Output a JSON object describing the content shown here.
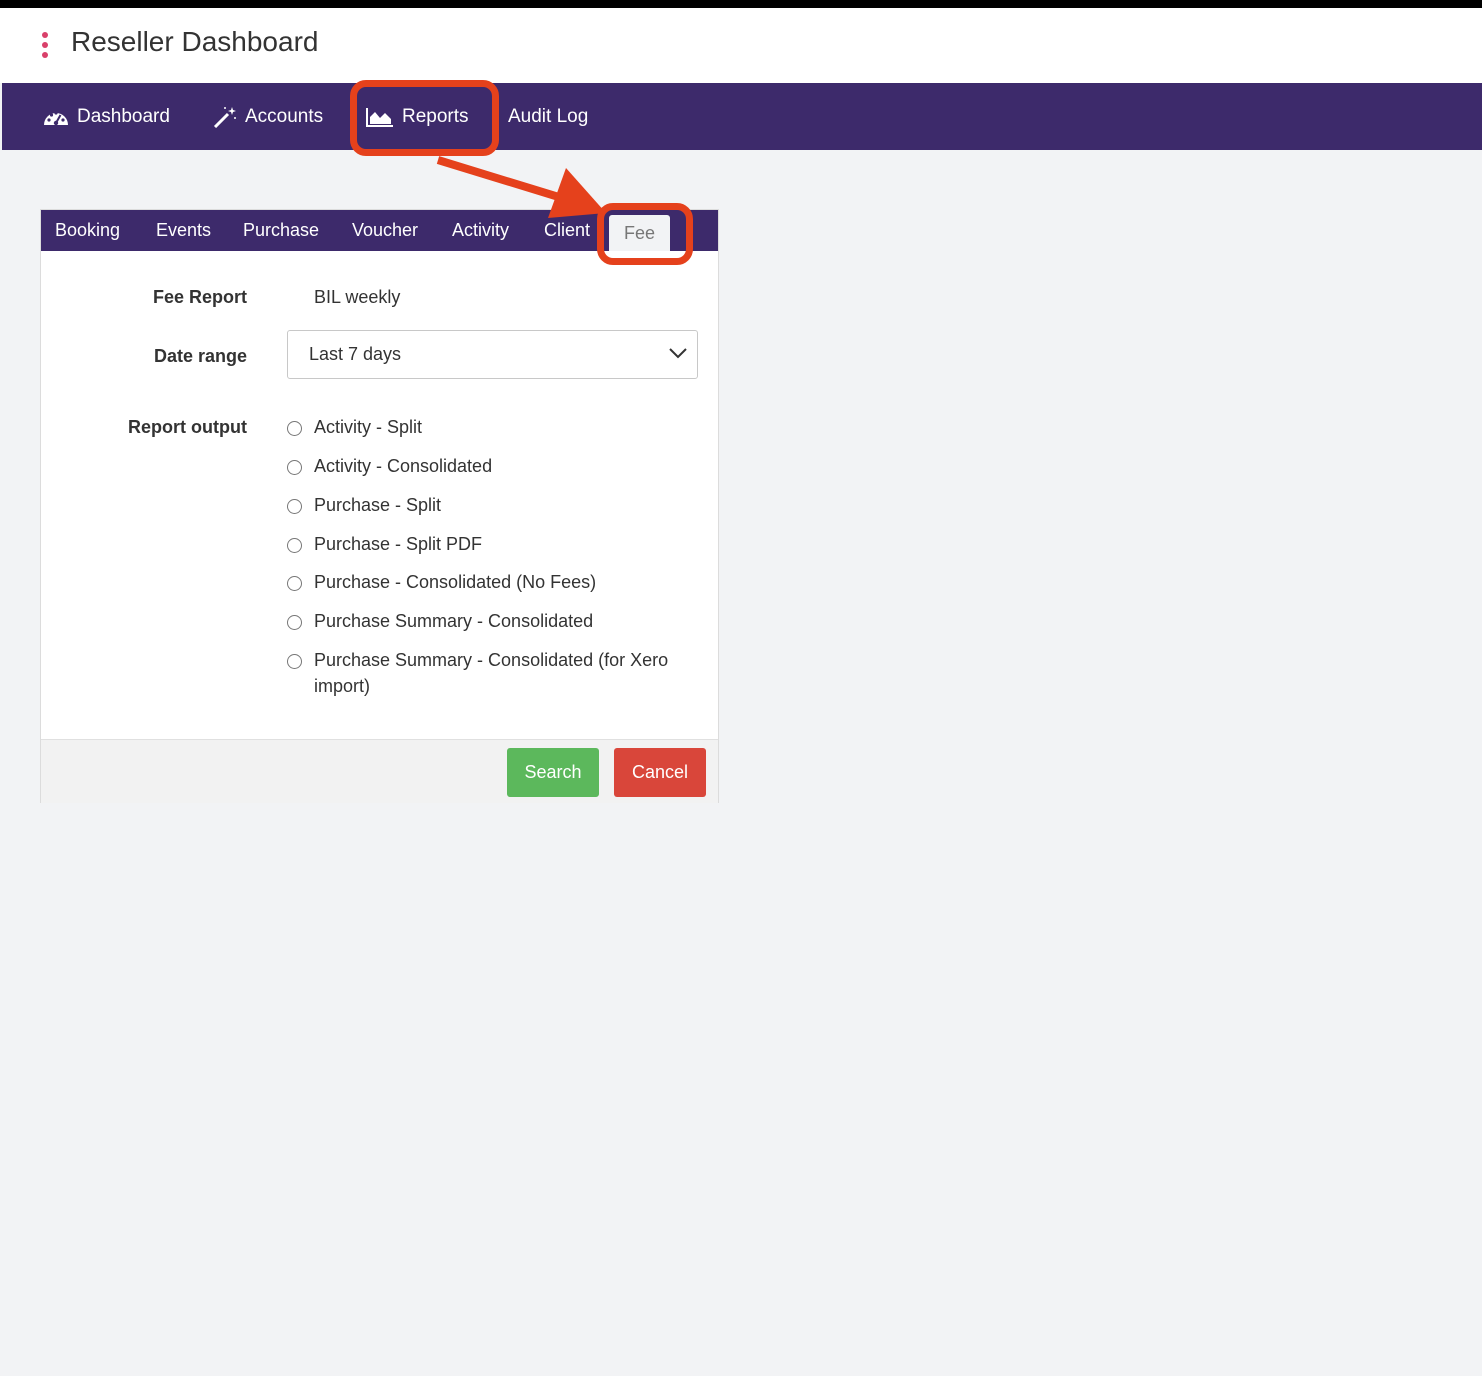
{
  "app": {
    "title": "Reseller Dashboard"
  },
  "nav": {
    "items": [
      {
        "label": "Dashboard",
        "icon": "dashboard-icon"
      },
      {
        "label": "Accounts",
        "icon": "magic-wand-icon"
      },
      {
        "label": "Reports",
        "icon": "area-chart-icon"
      },
      {
        "label": "Audit Log",
        "icon": ""
      }
    ]
  },
  "tabs": [
    "Booking",
    "Events",
    "Purchase",
    "Voucher",
    "Activity",
    "Client",
    "Fee"
  ],
  "active_tab": "Fee",
  "form": {
    "fee_report_label": "Fee Report",
    "fee_report_value": "BIL weekly",
    "date_range_label": "Date range",
    "date_range_value": "Last 7 days",
    "report_output_label": "Report output",
    "options": [
      "Activity - Split",
      "Activity - Consolidated",
      "Purchase - Split",
      "Purchase - Split PDF",
      "Purchase - Consolidated (No Fees)",
      "Purchase Summary - Consolidated",
      "Purchase Summary - Consolidated (for Xero import)"
    ]
  },
  "buttons": {
    "search": "Search",
    "cancel": "Cancel"
  },
  "colors": {
    "nav_bg": "#3d2a6b",
    "search_button": "#5cb85c",
    "cancel_button": "#d9463a",
    "annotation": "#e5411c",
    "kebab": "#d9406a"
  }
}
